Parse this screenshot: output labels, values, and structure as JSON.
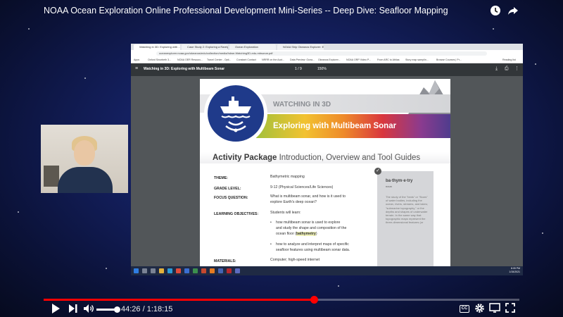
{
  "video": {
    "title": "NOAA Ocean Exploration Online Professional Development Mini-Series -- Deep Dive: Seafloor Mapping",
    "time_current": "44:26",
    "time_total": "1:18:15",
    "time_display": "44:26 / 1:18:15",
    "progress_fraction": 0.568,
    "volume_fraction": 0.95
  },
  "icons": {
    "watch_later": "clock-icon",
    "share": "share-arrow-icon",
    "play": "play-icon",
    "next": "skip-next-icon",
    "volume": "volume-icon",
    "captions": "closed-captions-icon",
    "settings": "gear-icon",
    "theater": "theater-mode-icon",
    "fullscreen": "fullscreen-icon"
  },
  "captions_label": "CC",
  "browser": {
    "tabs": [
      "Watching in 3D: Exploring with ...",
      "Case Study 2: Exploring a Rarely",
      "Ocean Exploration",
      "NOAA Ship Okeanos Explorer: E..."
    ],
    "address": "oceanexplorer.noaa.gov/okeanos/edu/collection/media/hdwe-Watching3D-edu-mbsonar.pdf",
    "bookmarks": [
      "Apps",
      "Oxford Sinorbeth 3...",
      "NOAA OER Resourc...",
      "Travel Center - Opti...",
      "Constant Contact",
      "NRRR on the Acct...",
      "Data Preview: Ocea...",
      "Okeanos Explorer...",
      "NOAA ORP Video P...",
      "From ARC to Athlas",
      "Story map samplin...",
      "Browse Courses | Pr...",
      "Reading list"
    ]
  },
  "pdf": {
    "title": "Watching in 3D: Exploring with Multibeam Sonar",
    "page_current": "1",
    "page_total": "9",
    "page_display": "1 / 9",
    "zoom": "150%"
  },
  "document": {
    "kicker": "WATCHING IN 3D",
    "headline": "Exploring with Multibeam Sonar",
    "package_bold": "Activity Package",
    "package_rest": " Introduction, Overview and Tool Guides",
    "theme_label": "THEME:",
    "theme_value": "Bathymetric mapping",
    "grade_label": "GRADE LEVEL:",
    "grade_value": "9-12 (Physical Sciences/Life Sciences)",
    "focus_label": "FOCUS QUESTION:",
    "focus_line1": "What is multibeam sonar, and how is it used to",
    "focus_line2": "explore Earth's deep ocean?",
    "objectives_label": "LEARNING OBJECTIVES:",
    "objectives_intro": "Students will learn:",
    "objective1_line1": "how multibeam sonar is used to explore",
    "objective1_line2": "and study the shape and composition of the",
    "objective1_line3_pre": "ocean floor (",
    "objective1_line3_hl": "bathymetry",
    "objective1_line3_post": ")",
    "objective2_line1": "how to analyze and interpret maps of specific",
    "objective2_line2": "seafloor features using multibeam sonar data.",
    "materials_label": "MATERIALS:",
    "materials_value": "Computer; high-speed internet",
    "sidebar_word": "ba·thym·e·try",
    "sidebar_pos": "noun",
    "sidebar_def": "The study of the \"beds\" or \"floors\" of water bodies, including the ocean, rivers, streams, and lakes; \"submarine topography,\" or the depths and shapes of underwater terrain. In the same way that topographic maps represent the three-dimensional features (or"
  },
  "taskbar": {
    "time": "8:05 PM",
    "date": "1/15/2021"
  }
}
